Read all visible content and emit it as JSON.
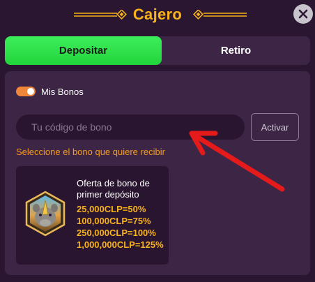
{
  "header": {
    "title": "Cajero"
  },
  "tabs": [
    {
      "label": "Depositar",
      "active": true
    },
    {
      "label": "Retiro",
      "active": false
    }
  ],
  "bonus_toggle": {
    "label": "Mis Bonos",
    "on": true
  },
  "code_input": {
    "placeholder": "Tu código de bono",
    "value": ""
  },
  "activate_button": {
    "label": "Activar"
  },
  "hint": "Seleccione el bono que quiere recibir",
  "bonus_offer": {
    "title": "Oferta de bono de primer depósito",
    "tiers": [
      "25,000CLP=50%",
      "100,000CLP=75%",
      "250,000CLP=100%",
      "1,000,000CLP=125%"
    ]
  },
  "colors": {
    "background": "#2b1631",
    "panel": "#3d2546",
    "accent_gold": "#f7b21c",
    "active_tab": "#2fe24a",
    "hint_orange": "#f59a1d",
    "annotation_arrow": "#e51b1b"
  },
  "icons": [
    "close-icon",
    "rhino-bonus-icon",
    "diamond-ornament-icon"
  ]
}
